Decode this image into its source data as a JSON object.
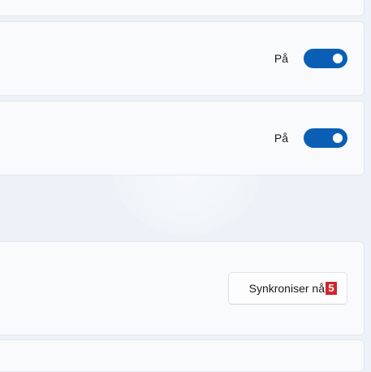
{
  "settings": {
    "toggle_1": {
      "state_label": "På",
      "on": true
    },
    "toggle_2": {
      "state_label": "På",
      "on": true
    },
    "sync": {
      "button_label": "Synkroniser nå",
      "badge": "5"
    }
  },
  "colors": {
    "accent": "#0a5fb4",
    "badge": "#d3242b",
    "page_background": "#edf2f8",
    "card_background": "#f9fafc"
  }
}
